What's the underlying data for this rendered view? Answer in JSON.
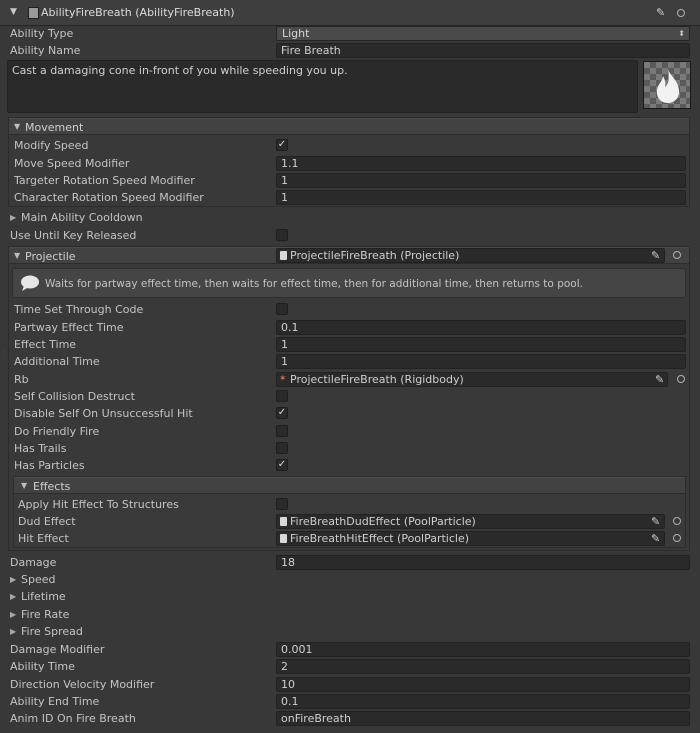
{
  "header": {
    "title": "AbilityFireBreath (AbilityFireBreath)"
  },
  "ability_type": {
    "label": "Ability Type",
    "value": "Light"
  },
  "ability_name": {
    "label": "Ability Name",
    "value": "Fire Breath"
  },
  "description": "Cast a damaging cone in-front of you while speeding you up.",
  "movement": {
    "header": "Movement",
    "modify_speed": "Modify Speed",
    "move_speed_modifier": {
      "label": "Move Speed Modifier",
      "value": "1.1"
    },
    "targeter_rotation": {
      "label": "Targeter Rotation Speed Modifier",
      "value": "1"
    },
    "character_rotation": {
      "label": "Character Rotation Speed Modifier",
      "value": "1"
    }
  },
  "main_ability_cooldown": "Main Ability Cooldown",
  "use_until_key_released": "Use Until Key Released",
  "projectile": {
    "label": "Projectile",
    "value": "ProjectileFireBreath (Projectile)",
    "help": "Waits for partway effect time, then waits for effect time, then for additional time, then returns to pool.",
    "time_set_through_code": "Time Set Through Code",
    "partway_effect_time": {
      "label": "Partway Effect Time",
      "value": "0.1"
    },
    "effect_time": {
      "label": "Effect Time",
      "value": "1"
    },
    "additional_time": {
      "label": "Additional Time",
      "value": "1"
    },
    "rb": {
      "label": "Rb",
      "value": "ProjectileFireBreath (Rigidbody)"
    },
    "self_collision_destruct": "Self Collision Destruct",
    "disable_self": "Disable Self On Unsuccessful Hit",
    "do_friendly_fire": "Do Friendly Fire",
    "has_trails": "Has Trails",
    "has_particles": "Has Particles",
    "effects": {
      "header": "Effects",
      "apply_hit_effect": "Apply Hit Effect To Structures",
      "dud_effect": {
        "label": "Dud Effect",
        "value": "FireBreathDudEffect (PoolParticle)"
      },
      "hit_effect": {
        "label": "Hit Effect",
        "value": "FireBreathHitEffect (PoolParticle)"
      }
    }
  },
  "damage": {
    "label": "Damage",
    "value": "18"
  },
  "foldouts": {
    "speed": "Speed",
    "lifetime": "Lifetime",
    "fire_rate": "Fire Rate",
    "fire_spread": "Fire Spread"
  },
  "damage_modifier": {
    "label": "Damage Modifier",
    "value": "0.001"
  },
  "ability_time": {
    "label": "Ability Time",
    "value": "2"
  },
  "direction_velocity_modifier": {
    "label": "Direction Velocity Modifier",
    "value": "10"
  },
  "ability_end_time": {
    "label": "Ability End Time",
    "value": "0.1"
  },
  "anim_id": {
    "label": "Anim ID On Fire Breath",
    "value": "onFireBreath"
  }
}
